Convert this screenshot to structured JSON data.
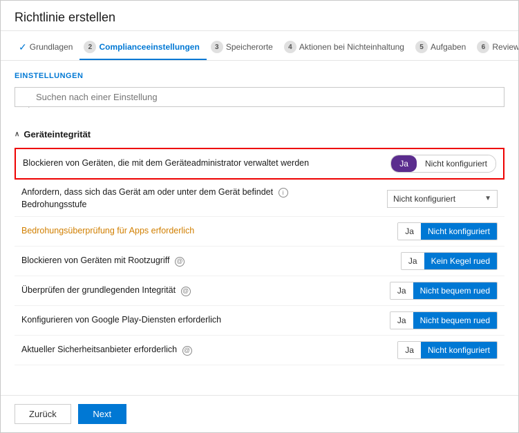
{
  "window": {
    "title": "Richtlinie erstellen"
  },
  "tabs": [
    {
      "id": "grundlagen",
      "label": "Grundlagen",
      "number": null,
      "completed": true,
      "active": false
    },
    {
      "id": "compliance",
      "label": "Complianceeinstellungen",
      "number": "2",
      "completed": false,
      "active": true
    },
    {
      "id": "speicherorte",
      "label": "Speicherorte",
      "number": "3",
      "completed": false,
      "active": false
    },
    {
      "id": "aktionen",
      "label": "Aktionen bei Nichteinhaltung",
      "number": "4",
      "completed": false,
      "active": false
    },
    {
      "id": "aufgaben",
      "label": "Aufgaben",
      "number": "5",
      "completed": false,
      "active": false
    },
    {
      "id": "review",
      "label": "Review",
      "number": "6",
      "completed": false,
      "active": false
    }
  ],
  "section_title": "EINSTELLUNGEN",
  "search": {
    "placeholder": "Suchen nach einer Einstellung"
  },
  "group": {
    "label": "Geräteintegrität"
  },
  "settings": [
    {
      "id": "blockieren-geraeteadmin",
      "label": "Blockieren von Geräten, die mit dem Geräteadministrator verwaltet werden",
      "highlighted": true,
      "control_type": "toggle",
      "option_left": "Ja",
      "option_right": "Nicht konfiguriert",
      "active_side": "left",
      "label_color": "normal"
    },
    {
      "id": "anfordern-geraetebedrohung",
      "label": "Anfordern, dass sich das Gerät am oder unter dem Gerät befindet\nBedrohungsstufe",
      "highlighted": false,
      "control_type": "dropdown",
      "dropdown_value": "Nicht konfiguriert",
      "label_color": "normal"
    },
    {
      "id": "bedrohungsueberpruefung",
      "label": "Bedrohungsüberprüfung für Apps erforderlich",
      "highlighted": false,
      "control_type": "btngroup",
      "option_left": "Ja",
      "option_right": "Nicht konfiguriert",
      "active_side": "right",
      "label_color": "orange"
    },
    {
      "id": "blockieren-rootzugriff",
      "label": "Blockieren von Geräten mit Rootzugriff",
      "highlighted": false,
      "control_type": "btngroup",
      "option_left": "Ja",
      "option_right": "Kein Kegel rued",
      "active_side": "right",
      "label_color": "normal",
      "has_info": true
    },
    {
      "id": "ueberpruefung-integritaet",
      "label": "Überprüfen der grundlegenden Integrität",
      "highlighted": false,
      "control_type": "btngroup",
      "option_left": "Ja",
      "option_right": "Nicht bequem rued",
      "active_side": "right",
      "label_color": "normal",
      "has_info": true
    },
    {
      "id": "google-play",
      "label": "Konfigurieren von Google Play-Diensten erforderlich",
      "highlighted": false,
      "control_type": "btngroup",
      "option_left": "Ja",
      "option_right": "Nicht bequem rued",
      "active_side": "right",
      "label_color": "normal"
    },
    {
      "id": "sicherheitsanbieter",
      "label": "Aktueller Sicherheitsanbieter erforderlich",
      "highlighted": false,
      "control_type": "btngroup",
      "option_left": "Ja",
      "option_right": "Nicht konfiguriert",
      "active_side": "right",
      "label_color": "normal",
      "has_info": true
    }
  ],
  "footer": {
    "back_label": "Zurück",
    "next_label": "Next"
  }
}
